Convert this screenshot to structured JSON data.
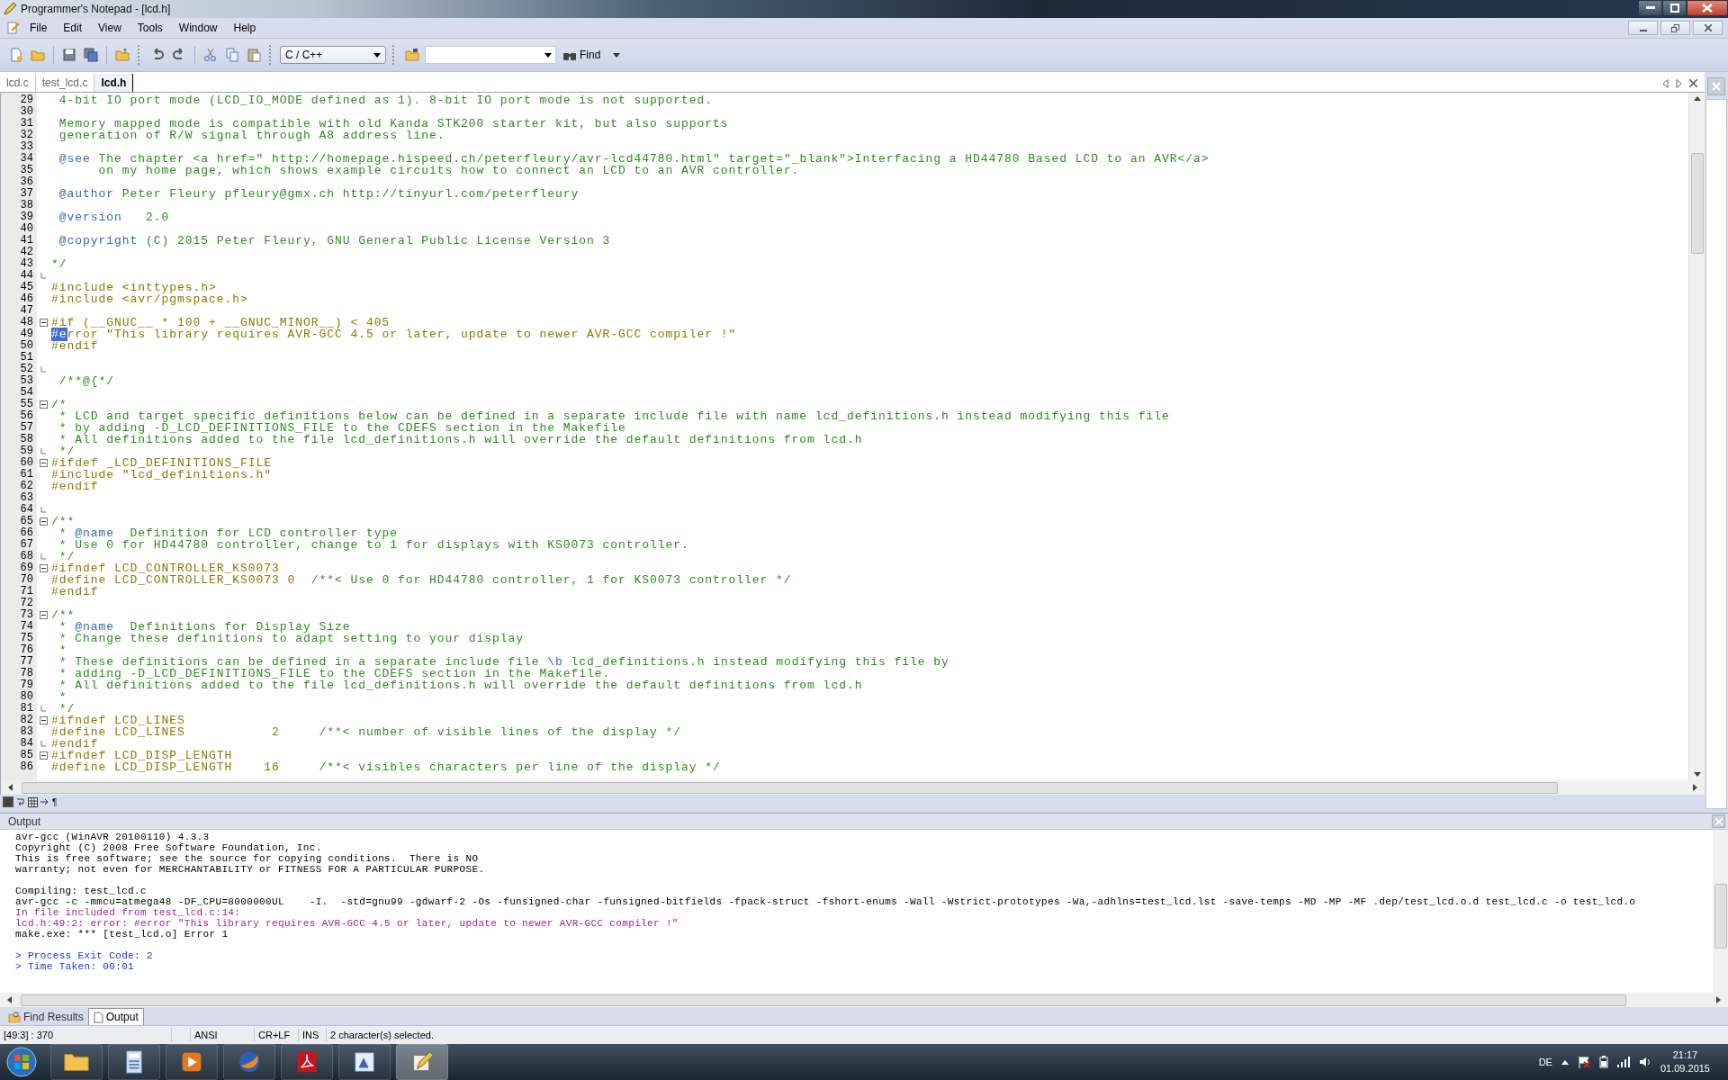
{
  "window": {
    "title": "Programmer's Notepad - [lcd.h]"
  },
  "menu": [
    "File",
    "Edit",
    "View",
    "Tools",
    "Window",
    "Help"
  ],
  "toolbar": {
    "language": "C / C++",
    "find_label": "Find"
  },
  "tabs": [
    {
      "label": "lcd.c",
      "selected": false
    },
    {
      "label": "test_lcd.c",
      "selected": false
    },
    {
      "label": "lcd.h",
      "selected": true
    }
  ],
  "editor": {
    "lines": [
      {
        "number": "29",
        "segments": [
          {
            "kind": "comment",
            "text": " 4-bit IO port mode (LCD_IO_MODE defined as 1). 8-bit IO port mode is not supported."
          }
        ]
      },
      {
        "number": "30"
      },
      {
        "number": "31",
        "segments": [
          {
            "kind": "comment",
            "text": " Memory mapped mode is compatible with old Kanda STK200 starter kit, but also supports"
          }
        ]
      },
      {
        "number": "32",
        "segments": [
          {
            "kind": "comment",
            "text": " generation of R/W signal through A8 address line."
          }
        ]
      },
      {
        "number": "33"
      },
      {
        "number": "34",
        "segments": [
          {
            "kind": "doctag",
            "text": " @see"
          },
          {
            "kind": "comment",
            "text": " The chapter <a href=\" http://homepage.hispeed.ch/peterfleury/avr-lcd44780.html\" target=\"_blank\">Interfacing a HD44780 Based LCD to an AVR</a>"
          }
        ]
      },
      {
        "number": "35",
        "segments": [
          {
            "kind": "comment",
            "text": "      on my home page, which shows example circuits how to connect an LCD to an AVR controller."
          }
        ]
      },
      {
        "number": "36"
      },
      {
        "number": "37",
        "segments": [
          {
            "kind": "doctag",
            "text": " @author"
          },
          {
            "kind": "comment",
            "text": " Peter Fleury pfleury@gmx.ch http://tinyurl.com/peterfleury"
          }
        ]
      },
      {
        "number": "38"
      },
      {
        "number": "39",
        "segments": [
          {
            "kind": "doctag",
            "text": " @version"
          },
          {
            "kind": "comment",
            "text": "   2.0"
          }
        ]
      },
      {
        "number": "40"
      },
      {
        "number": "41",
        "segments": [
          {
            "kind": "doctag",
            "text": " @copyright"
          },
          {
            "kind": "comment",
            "text": " (C) 2015 Peter Fleury, GNU General Public License Version 3"
          }
        ]
      },
      {
        "number": "42"
      },
      {
        "number": "43",
        "segments": [
          {
            "kind": "comment",
            "text": "*/"
          }
        ]
      },
      {
        "number": "44",
        "fold_end": true
      },
      {
        "number": "45",
        "segments": [
          {
            "kind": "preproc",
            "text": "#include <inttypes.h>"
          }
        ]
      },
      {
        "number": "46",
        "segments": [
          {
            "kind": "preproc",
            "text": "#include <avr/pgmspace.h>"
          }
        ]
      },
      {
        "number": "47"
      },
      {
        "number": "48",
        "fold_start": true,
        "segments": [
          {
            "kind": "preproc",
            "text": "#if (__GNUC__ * 100 + __GNUC_MINOR__) < 405"
          }
        ]
      },
      {
        "number": "49",
        "segments": [
          {
            "kind": "selection",
            "text": "#e"
          },
          {
            "kind": "preproc",
            "text": "rror \"This library requires AVR-GCC 4.5 or later, update to newer AVR-GCC compiler !\""
          }
        ]
      },
      {
        "number": "50",
        "segments": [
          {
            "kind": "preproc",
            "text": "#endif"
          }
        ]
      },
      {
        "number": "51"
      },
      {
        "number": "52",
        "fold_end": true
      },
      {
        "number": "53",
        "segments": [
          {
            "kind": "comment",
            "text": " /**@{*/"
          }
        ]
      },
      {
        "number": "54"
      },
      {
        "number": "55",
        "fold_start": true,
        "segments": [
          {
            "kind": "comment",
            "text": "/*"
          }
        ]
      },
      {
        "number": "56",
        "segments": [
          {
            "kind": "comment",
            "text": " * LCD and target specific definitions below can be defined in a separate include file with name lcd_definitions.h instead modifying this file"
          }
        ]
      },
      {
        "number": "57",
        "segments": [
          {
            "kind": "comment",
            "text": " * by adding -D_LCD_DEFINITIONS_FILE to the CDEFS section in the Makefile"
          }
        ]
      },
      {
        "number": "58",
        "segments": [
          {
            "kind": "comment",
            "text": " * All definitions added to the file lcd_definitions.h will override the default definitions from lcd.h"
          }
        ]
      },
      {
        "number": "59",
        "fold_end": true,
        "segments": [
          {
            "kind": "comment",
            "text": " */"
          }
        ]
      },
      {
        "number": "60",
        "fold_start": true,
        "segments": [
          {
            "kind": "preproc",
            "text": "#ifdef _LCD_DEFINITIONS_FILE"
          }
        ]
      },
      {
        "number": "61",
        "segments": [
          {
            "kind": "preproc",
            "text": "#include \"lcd_definitions.h\""
          }
        ]
      },
      {
        "number": "62",
        "segments": [
          {
            "kind": "preproc",
            "text": "#endif"
          }
        ]
      },
      {
        "number": "63"
      },
      {
        "number": "64",
        "fold_end": true
      },
      {
        "number": "65",
        "fold_start": true,
        "segments": [
          {
            "kind": "comment",
            "text": "/**"
          }
        ]
      },
      {
        "number": "66",
        "segments": [
          {
            "kind": "comment",
            "text": " * "
          },
          {
            "kind": "doctag",
            "text": "@name"
          },
          {
            "kind": "comment",
            "text": "  Definition for LCD controller type"
          }
        ]
      },
      {
        "number": "67",
        "segments": [
          {
            "kind": "comment",
            "text": " * Use 0 for HD44780 controller, change to 1 for displays with KS0073 controller."
          }
        ]
      },
      {
        "number": "68",
        "fold_end": true,
        "segments": [
          {
            "kind": "comment",
            "text": " */"
          }
        ]
      },
      {
        "number": "69",
        "fold_start": true,
        "segments": [
          {
            "kind": "preproc",
            "text": "#ifndef LCD_CONTROLLER_KS0073"
          }
        ]
      },
      {
        "number": "70",
        "segments": [
          {
            "kind": "preproc",
            "text": "#define LCD_CONTROLLER_KS0073 0  "
          },
          {
            "kind": "comment",
            "text": "/**< Use 0 for HD44780 controller, 1 for KS0073 controller */"
          }
        ]
      },
      {
        "number": "71",
        "segments": [
          {
            "kind": "preproc",
            "text": "#endif"
          }
        ]
      },
      {
        "number": "72"
      },
      {
        "number": "73",
        "fold_start": true,
        "segments": [
          {
            "kind": "comment",
            "text": "/**"
          }
        ]
      },
      {
        "number": "74",
        "segments": [
          {
            "kind": "comment",
            "text": " * "
          },
          {
            "kind": "doctag",
            "text": "@name"
          },
          {
            "kind": "comment",
            "text": "  Definitions for Display Size"
          }
        ]
      },
      {
        "number": "75",
        "segments": [
          {
            "kind": "comment",
            "text": " * Change these definitions to adapt setting to your display"
          }
        ]
      },
      {
        "number": "76",
        "segments": [
          {
            "kind": "comment",
            "text": " *"
          }
        ]
      },
      {
        "number": "77",
        "segments": [
          {
            "kind": "comment",
            "text": " * These definitions can be defined in a separate include file "
          },
          {
            "kind": "doctag",
            "text": "\\b"
          },
          {
            "kind": "comment",
            "text": " lcd_definitions.h instead modifying this file by"
          }
        ]
      },
      {
        "number": "78",
        "segments": [
          {
            "kind": "comment",
            "text": " * adding -D_LCD_DEFINITIONS_FILE to the CDEFS section in the Makefile."
          }
        ]
      },
      {
        "number": "79",
        "segments": [
          {
            "kind": "comment",
            "text": " * All definitions added to the file lcd_definitions.h will override the default definitions from lcd.h"
          }
        ]
      },
      {
        "number": "80",
        "segments": [
          {
            "kind": "comment",
            "text": " *"
          }
        ]
      },
      {
        "number": "81",
        "fold_end": true,
        "segments": [
          {
            "kind": "comment",
            "text": " */"
          }
        ]
      },
      {
        "number": "82",
        "fold_start": true,
        "segments": [
          {
            "kind": "preproc",
            "text": "#ifndef LCD_LINES"
          }
        ]
      },
      {
        "number": "83",
        "segments": [
          {
            "kind": "preproc",
            "text": "#define LCD_LINES           2     "
          },
          {
            "kind": "comment",
            "text": "/**< number of visible lines of the display */"
          }
        ]
      },
      {
        "number": "84",
        "fold_end": true,
        "segments": [
          {
            "kind": "preproc",
            "text": "#endif"
          }
        ]
      },
      {
        "number": "85",
        "fold_start": true,
        "segments": [
          {
            "kind": "preproc",
            "text": "#ifndef LCD_DISP_LENGTH"
          }
        ]
      },
      {
        "number": "86",
        "segments": [
          {
            "kind": "preproc",
            "text": "#define LCD_DISP_LENGTH    16     "
          },
          {
            "kind": "comment",
            "text": "/**< visibles characters per line of the display */"
          }
        ]
      }
    ]
  },
  "mini_toolbar": {
    "whitespace_toggle": "¶"
  },
  "output": {
    "title": "Output",
    "blocks": [
      {
        "lines": [
          {
            "kind": "plain",
            "text": "avr-gcc (WinAVR 20100110) 4.3.3"
          },
          {
            "kind": "plain",
            "text": "Copyright (C) 2008 Free Software Foundation, Inc."
          },
          {
            "kind": "plain",
            "text": "This is free software; see the source for copying conditions.  There is NO"
          },
          {
            "kind": "plain",
            "text": "warranty; not even for MERCHANTABILITY or FITNESS FOR A PARTICULAR PURPOSE."
          }
        ]
      },
      {
        "lines": [
          {
            "kind": "plain",
            "text": "Compiling: test_lcd.c"
          },
          {
            "kind": "plain",
            "text": "avr-gcc -c -mmcu=atmega48 -DF_CPU=8000000UL    -I.  -std=gnu99 -gdwarf-2 -Os -funsigned-char -funsigned-bitfields -fpack-struct -fshort-enums -Wall -Wstrict-prototypes -Wa,-adhlns=test_lcd.lst -save-temps -MD -MP -MF .dep/test_lcd.o.d test_lcd.c -o test_lcd.o"
          },
          {
            "kind": "message",
            "text": "In file included from test_lcd.c:14:"
          },
          {
            "kind": "message",
            "text": "lcd.h:49:2: error: #error \"This library requires AVR-GCC 4.5 or later, update to newer AVR-GCC compiler !\""
          },
          {
            "kind": "plain",
            "text": "make.exe: *** [test_lcd.o] Error 1"
          }
        ]
      },
      {
        "lines": [
          {
            "kind": "summary",
            "text": "> Process Exit Code: 2"
          },
          {
            "kind": "summary",
            "text": "> Time Taken: 00:01"
          }
        ]
      }
    ]
  },
  "bottom_tabs": [
    {
      "label": "Find Results",
      "selected": false
    },
    {
      "label": "Output",
      "selected": true
    }
  ],
  "status_bar": {
    "position": "[49:3] : 370",
    "encoding": "ANSI",
    "line_ending": "CR+LF",
    "mode": "INS",
    "message": "2 character(s) selected."
  },
  "taskbar": {
    "language": "DE",
    "time": "21:17",
    "date": "01.09.2015"
  }
}
